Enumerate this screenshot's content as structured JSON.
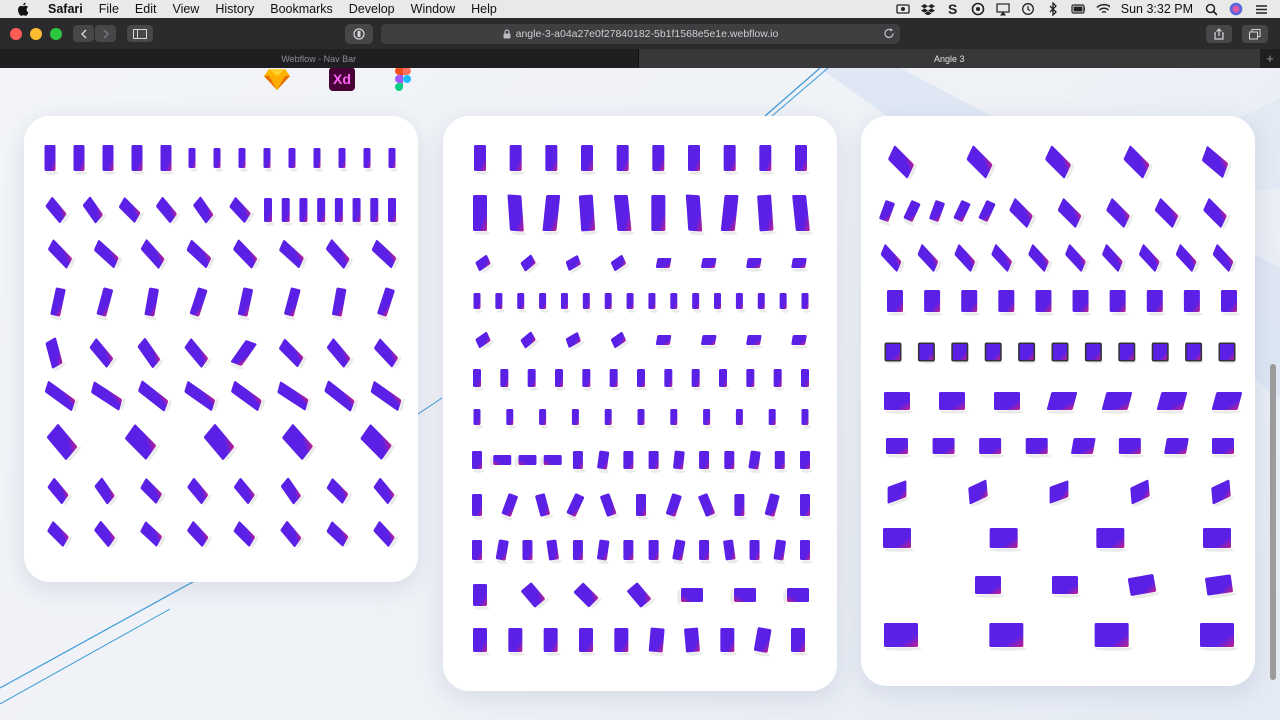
{
  "menubar": {
    "apple": "apple-icon",
    "items": [
      "Safari",
      "File",
      "Edit",
      "View",
      "History",
      "Bookmarks",
      "Develop",
      "Window",
      "Help"
    ],
    "clock": "Sun 3:32 PM",
    "status_icons": [
      "screen-record-icon",
      "dropbox-icon",
      "script-icon",
      "at-sign-icon",
      "airplay-icon",
      "time-machine-icon",
      "bluetooth-icon",
      "wifi-icon",
      "battery-icon",
      "spotlight-icon",
      "siri-icon",
      "control-center-icon"
    ]
  },
  "toolbar": {
    "url": "angle-3-a04a27e0f27840182-5b1f1568e5e1e.webflow.io"
  },
  "tabs": [
    {
      "label": "Webflow - Nav Bar",
      "active": false
    },
    {
      "label": "Angle 3",
      "active": true
    }
  ],
  "logos": {
    "xd": "Xd",
    "items": [
      "sketch-icon",
      "adobe-xd-icon",
      "figma-icon"
    ]
  },
  "colors": {
    "device_purple": "#5b20e6",
    "device_pink": "#c1208c",
    "accent_line": "#3a9ad9"
  },
  "cards": [
    {
      "name": "angle-card-phones"
    },
    {
      "name": "angle-card-tablets"
    },
    {
      "name": "angle-card-computers"
    }
  ]
}
